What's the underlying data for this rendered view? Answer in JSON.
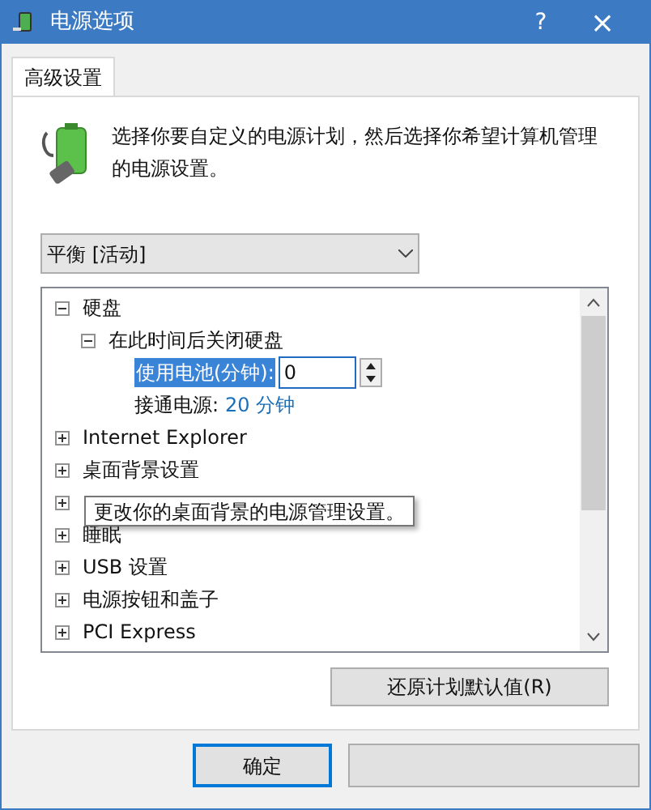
{
  "window": {
    "title": "电源选项",
    "help": "?",
    "close": "×"
  },
  "tabs": [
    {
      "label": "高级设置",
      "selected": true
    }
  ],
  "description": "选择你要自定义的电源计划，然后选择你希望计算机管理的电源设置。",
  "plan_dropdown": {
    "value": "平衡 [活动]"
  },
  "tree": [
    {
      "kind": "group",
      "label": "硬盘",
      "expanded": true,
      "children": [
        {
          "kind": "group",
          "label": "在此时间后关闭硬盘",
          "expanded": true,
          "children": [
            {
              "kind": "spinner",
              "label": "使用电池(分钟):",
              "value": "0",
              "selected": true
            },
            {
              "kind": "value",
              "label": "接通电源:",
              "value": "20 分钟"
            }
          ]
        }
      ]
    },
    {
      "kind": "group",
      "label": "Internet Explorer",
      "expanded": false
    },
    {
      "kind": "group",
      "label": "桌面背景设置",
      "expanded": false
    },
    {
      "kind": "group",
      "expanded": false
    },
    {
      "kind": "group",
      "label": "睡眠",
      "expanded": false
    },
    {
      "kind": "group",
      "label": "USB 设置",
      "expanded": false
    },
    {
      "kind": "group",
      "label": "电源按钮和盖子",
      "expanded": false
    },
    {
      "kind": "group",
      "label": "PCI Express",
      "expanded": false
    }
  ],
  "tooltip": "更改你的桌面背景的电源管理设置。",
  "restore_button": "还原计划默认值(R)",
  "buttons": [
    {
      "label": "确定",
      "default": true
    },
    {
      "default": false
    }
  ]
}
